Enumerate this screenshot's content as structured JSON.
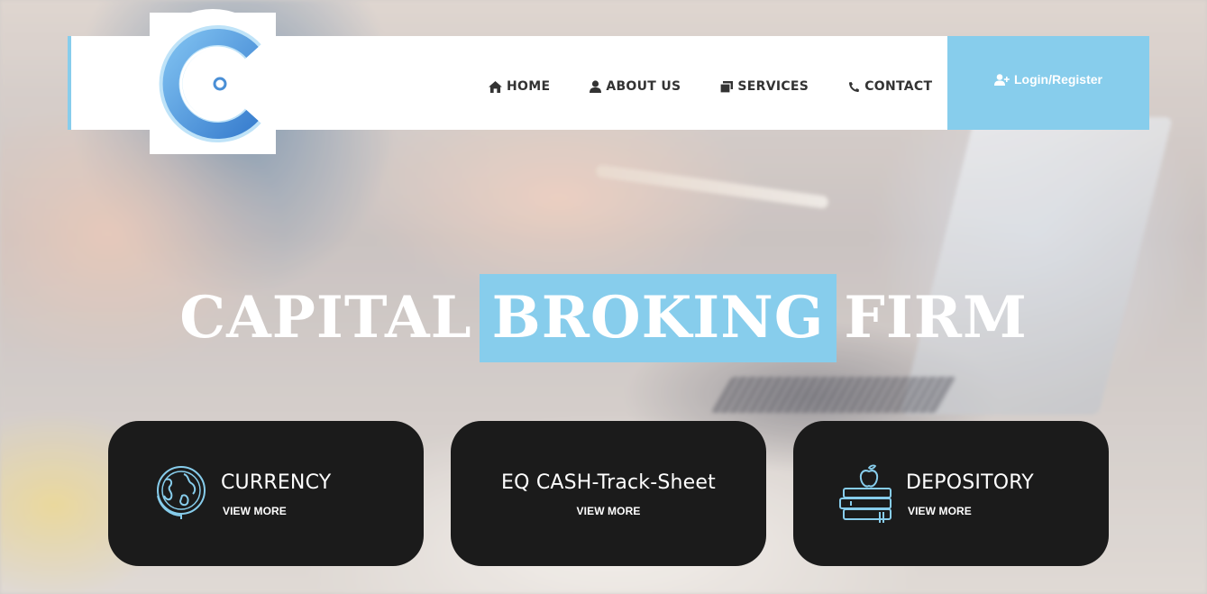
{
  "header": {
    "logo_letter": "C",
    "nav": [
      {
        "label": "HOME",
        "icon": "home-icon"
      },
      {
        "label": "ABOUT US",
        "icon": "user-icon"
      },
      {
        "label": "SERVICES",
        "icon": "clone-icon"
      },
      {
        "label": "CONTACT",
        "icon": "phone-icon"
      }
    ],
    "login_label": "Login/Register"
  },
  "hero": {
    "title_part1": "CAPITAL",
    "title_highlight": "BROKING",
    "title_part2": "FIRM"
  },
  "cards": [
    {
      "title": "CURRENCY",
      "link": "VIEW MORE",
      "icon": "globe-icon"
    },
    {
      "title": "EQ CASH-Track-Sheet",
      "link": "VIEW MORE",
      "icon": ""
    },
    {
      "title": "DEPOSITORY",
      "link": "VIEW MORE",
      "icon": "books-apple-icon"
    }
  ],
  "colors": {
    "accent": "#87cdec",
    "card_bg": "#1b1b1b",
    "nav_text": "#333333",
    "logo_blue": "#4a8fd6"
  }
}
